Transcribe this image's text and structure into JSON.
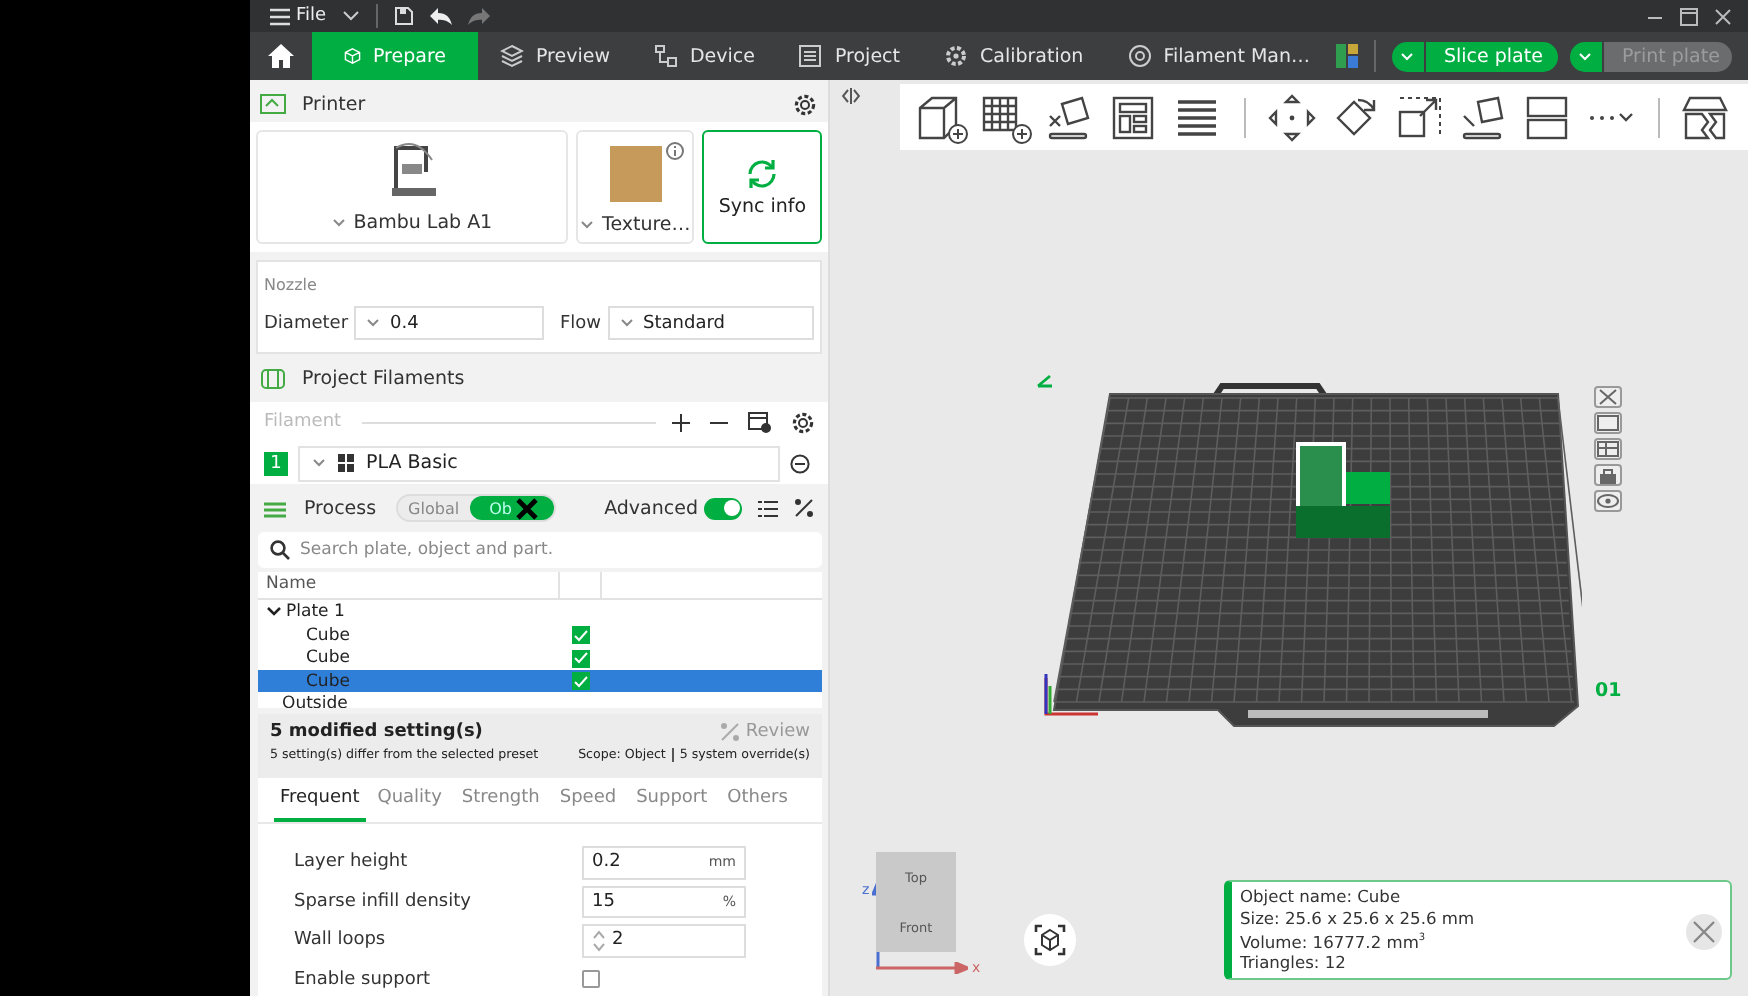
{
  "menu": {
    "file_label": "File"
  },
  "tabs": [
    {
      "label": "Prepare",
      "selected": true
    },
    {
      "label": "Preview",
      "selected": false
    },
    {
      "label": "Device",
      "selected": false
    },
    {
      "label": "Project",
      "selected": false
    },
    {
      "label": "Calibration",
      "selected": false
    },
    {
      "label": "Filament Man…",
      "selected": false
    }
  ],
  "actions": [
    {
      "label": "Slice plate",
      "disabled": false
    },
    {
      "label": "Print plate",
      "disabled": true
    }
  ],
  "printer": {
    "title": "Printer",
    "model": "Bambu Lab A1",
    "plate": "Texture…",
    "sync": "Sync info"
  },
  "nozzle": {
    "title": "Nozzle",
    "diameter_label": "Diameter",
    "diameter": "0.4",
    "flow_label": "Flow",
    "flow": "Standard"
  },
  "filaments": {
    "title": "Project Filaments",
    "label": "Filament",
    "items": [
      {
        "index": "1",
        "name": "PLA Basic",
        "color": "#00ae42"
      }
    ]
  },
  "process": {
    "title": "Process",
    "scopes": [
      {
        "label": "Global",
        "selected": false
      },
      {
        "label": "Ob",
        "selected": true
      }
    ],
    "advanced_label": "Advanced",
    "advanced": true
  },
  "search": {
    "placeholder": "Search plate, object and part."
  },
  "tree": {
    "column": "Name",
    "items": [
      {
        "name": "Plate 1",
        "expanded": true,
        "selected": false,
        "children": [
          {
            "name": "Cube",
            "checked": true,
            "selected": false
          },
          {
            "name": "Cube",
            "checked": true,
            "selected": false
          },
          {
            "name": "Cube",
            "checked": true,
            "selected": true
          }
        ]
      },
      {
        "name": "Outside",
        "selected": false
      }
    ]
  },
  "modified": {
    "title": "5 modified setting(s)",
    "note": "5 setting(s) differ from the selected preset",
    "review": "Review",
    "scope": "Scope: Object",
    "overrides": "5 system override(s)"
  },
  "settings_tabs": [
    {
      "label": "Frequent",
      "selected": true
    },
    {
      "label": "Quality",
      "selected": false
    },
    {
      "label": "Strength",
      "selected": false
    },
    {
      "label": "Speed",
      "selected": false
    },
    {
      "label": "Support",
      "selected": false
    },
    {
      "label": "Others",
      "selected": false
    }
  ],
  "settings": [
    {
      "kind": "unit",
      "label": "Layer height",
      "value": "0.2",
      "unit": "mm"
    },
    {
      "kind": "unit",
      "label": "Sparse infill density",
      "value": "15",
      "unit": "%"
    },
    {
      "kind": "spin",
      "label": "Wall loops",
      "value": "2"
    },
    {
      "kind": "check",
      "label": "Enable support",
      "checked": false
    }
  ],
  "viewport": {
    "plate_number": "01",
    "view_top": "Top",
    "view_front": "Front",
    "axis_z": "z",
    "axis_x": "x"
  },
  "info": {
    "lines": [
      "Object name: Cube",
      "Size: 25.6 x 25.6 x 25.6 mm",
      "Volume: 16777.2 mm$^{3}$",
      "Triangles: 12"
    ]
  }
}
